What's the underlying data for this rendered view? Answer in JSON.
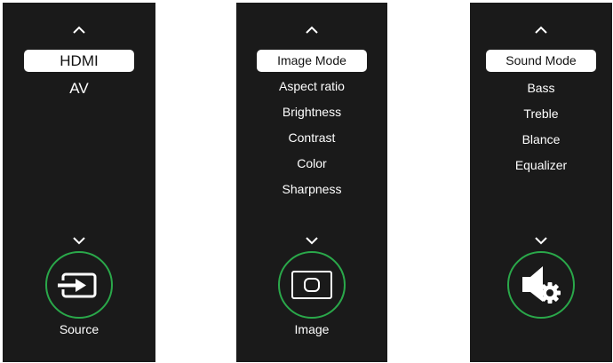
{
  "accent": "#2aa84a",
  "panels": {
    "source": {
      "label": "Source",
      "icon": "source-input-icon",
      "items": [
        "HDMI",
        "AV"
      ],
      "selected": "HDMI"
    },
    "image": {
      "label": "Image",
      "icon": "image-icon",
      "items": [
        "Image Mode",
        "Aspect ratio",
        "Brightness",
        "Contrast",
        "Color",
        "Sharpness"
      ],
      "selected": "Image Mode"
    },
    "sound": {
      "label": "",
      "icon": "speaker-settings-icon",
      "items": [
        "Sound Mode",
        "Bass",
        "Treble",
        "Blance",
        "Equalizer"
      ],
      "selected": "Sound Mode"
    }
  }
}
